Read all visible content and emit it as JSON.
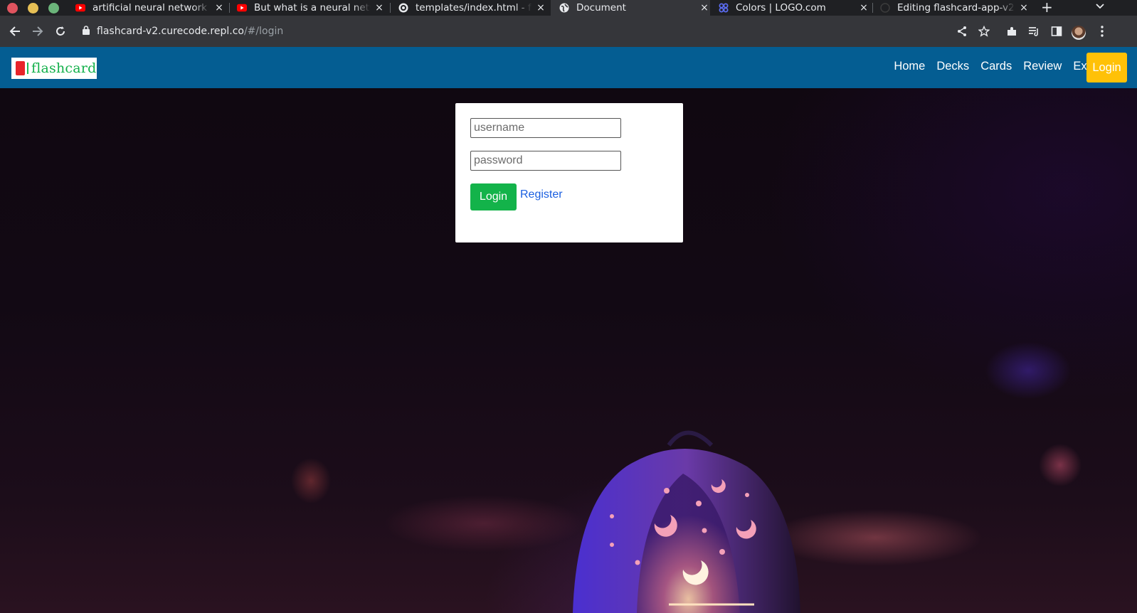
{
  "browser": {
    "tabs": [
      {
        "title": "artificial neural network",
        "favicon": "youtube-icon",
        "active": false
      },
      {
        "title": "But what is a neural network",
        "favicon": "youtube-icon",
        "active": false
      },
      {
        "title": "templates/index.html - f",
        "favicon": "replit-icon",
        "active": false
      },
      {
        "title": "Document",
        "favicon": "globe-icon",
        "active": true
      },
      {
        "title": "Colors | LOGO.com",
        "favicon": "logo-com-icon",
        "active": false
      },
      {
        "title": "Editing flashcard-app-v2",
        "favicon": "github-icon",
        "active": false
      }
    ],
    "new_tab_label": "+",
    "close_glyph": "×",
    "url_host": "flashcard-v2.curecode.repl.co",
    "url_path": "/#/login"
  },
  "navbar": {
    "brand": "flashcard",
    "links": [
      "Home",
      "Decks",
      "Cards",
      "Review",
      "Export"
    ],
    "login_label": "Login",
    "colors": {
      "navbar": "#045d92",
      "login_button": "#ffc107"
    }
  },
  "login_form": {
    "username_placeholder": "username",
    "password_placeholder": "password",
    "submit_label": "Login",
    "register_label": "Register",
    "colors": {
      "submit": "#13b34a",
      "link": "#1a5fe0"
    }
  }
}
